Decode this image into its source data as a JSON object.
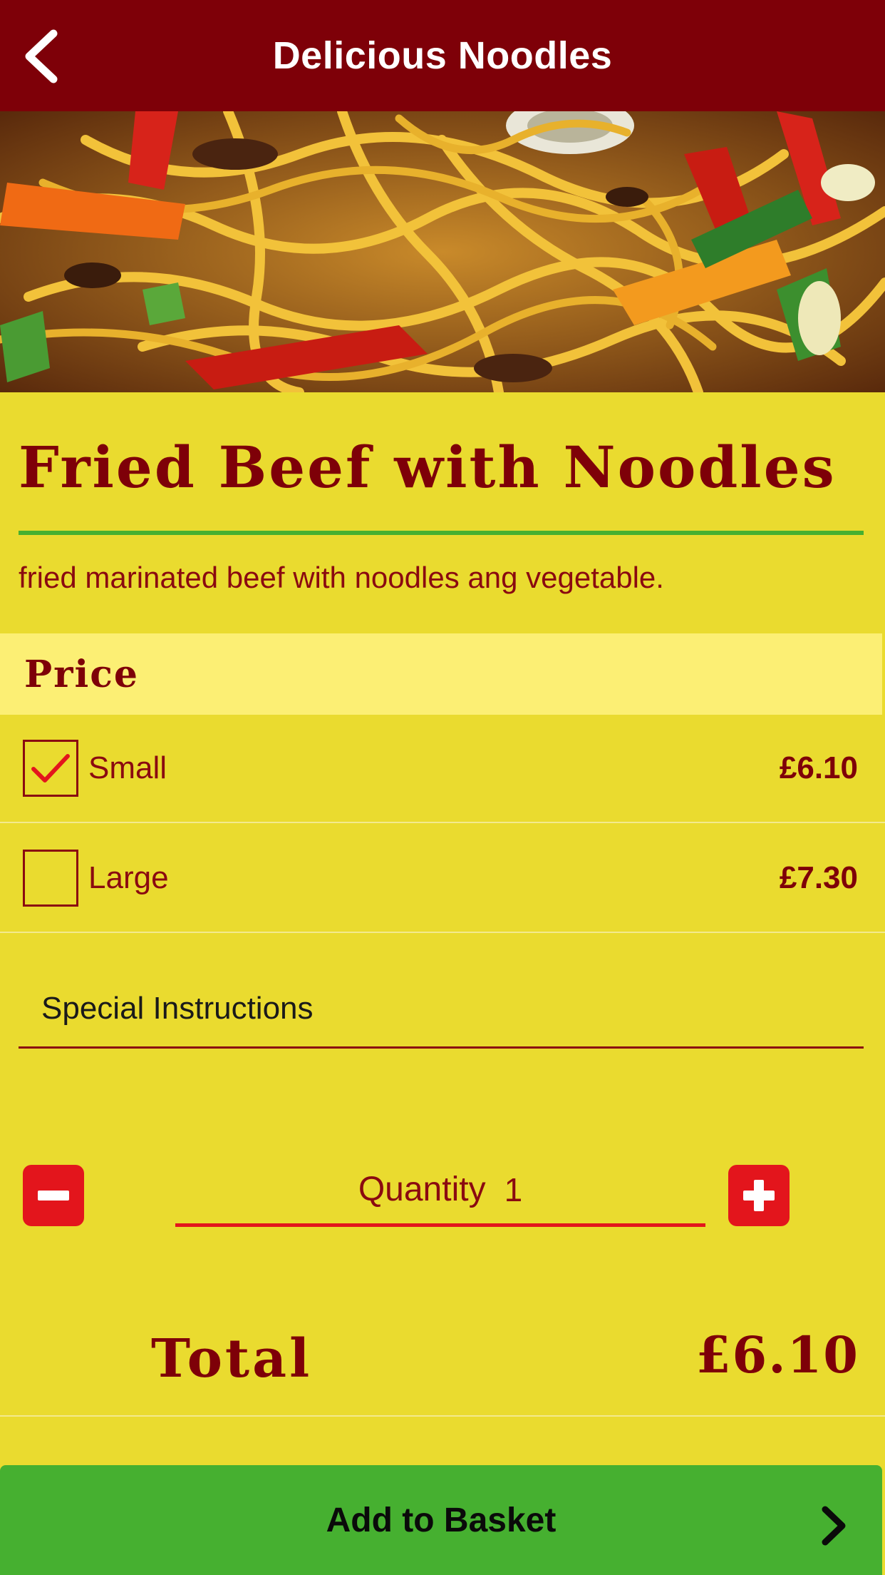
{
  "header": {
    "title": "Delicious Noodles",
    "back_icon": "chevron-left-icon"
  },
  "hero": {
    "image": "noodles-photo"
  },
  "dish": {
    "name": "Fried Beef with Noodles",
    "description": "fried marinated beef with noodles ang vegetable."
  },
  "price_section": {
    "label": "Price",
    "options": [
      {
        "name": "Small",
        "price": "£6.10",
        "checked": true
      },
      {
        "name": "Large",
        "price": "£7.30",
        "checked": false
      }
    ]
  },
  "instructions": {
    "placeholder": "Special Instructions",
    "value": ""
  },
  "quantity": {
    "label": "Quantity",
    "value": "1",
    "minus_icon": "minus-icon",
    "plus_icon": "plus-icon"
  },
  "total": {
    "label": "Total",
    "value": "£6.10"
  },
  "basket_button": {
    "label": "Add to Basket",
    "icon": "chevron-right-icon"
  },
  "colors": {
    "header_bg": "#7e0008",
    "page_bg": "#eadb2f",
    "price_header_bg": "#fcef74",
    "accent_green": "#46b030",
    "accent_red": "#e3151c",
    "text_maroon": "#7e0008"
  }
}
